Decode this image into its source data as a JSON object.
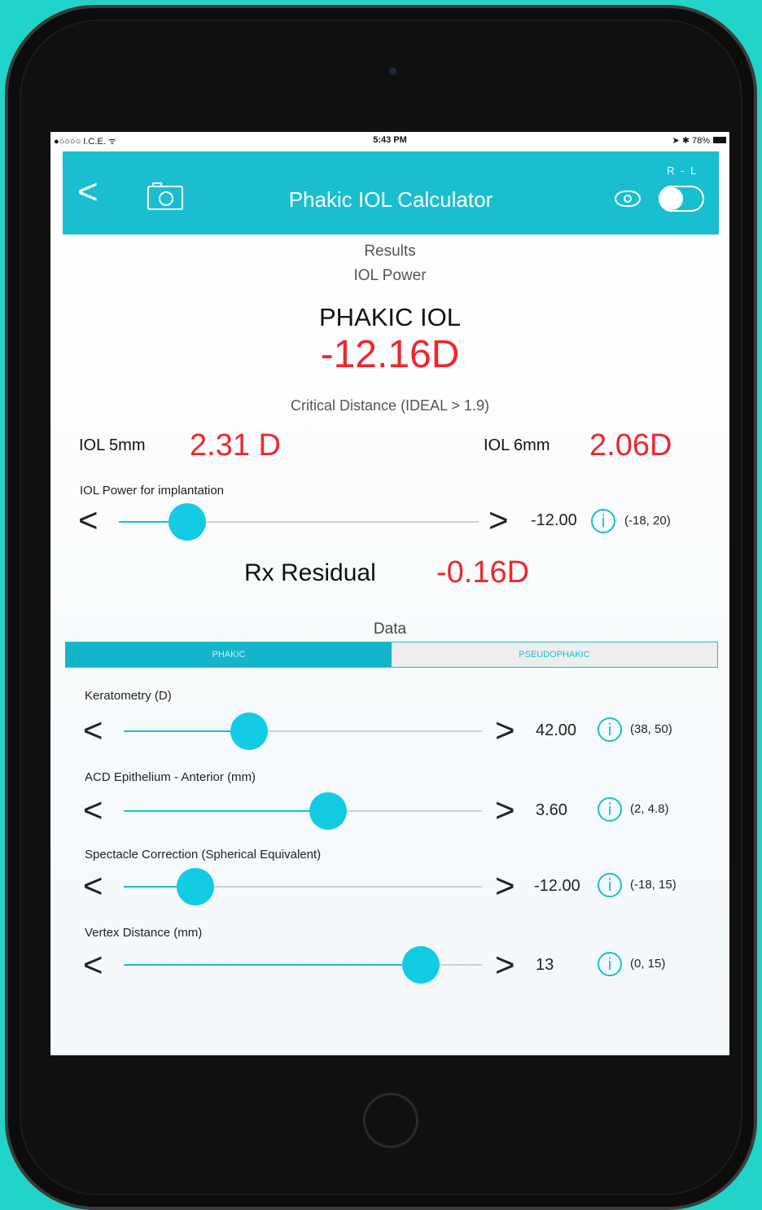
{
  "status_bar": {
    "carrier": "●○○○○ I.C.E. ᯤ",
    "time": "5:43 PM",
    "battery": "➤ ✱ 78%"
  },
  "nav": {
    "back_icon": "chevron-left-icon",
    "camera_icon": "camera-icon",
    "title": "Phakic IOL Calculator",
    "eye_icon": "eye-icon",
    "toggle_label": "R - L",
    "accent_color": "#19bfd0"
  },
  "results": {
    "heading": "Results",
    "subheading": "IOL Power",
    "phakic_label": "PHAKIC IOL",
    "phakic_value": "-12.16D",
    "critical_label": "Critical Distance (IDEAL > 1.9)",
    "iol5_label": "IOL 5mm",
    "iol5_value": "2.31 D",
    "iol6_label": "IOL 6mm",
    "iol6_value": "2.06D",
    "value_color": "#f0262a"
  },
  "implant_slider": {
    "label": "IOL Power for implantation",
    "value": "-12.00",
    "range": "(-18, 20)",
    "position": 0.19
  },
  "residual": {
    "label": "Rx Residual",
    "value": "-0.16D"
  },
  "data_section": {
    "title": "Data",
    "tabs": [
      "PHAKIC",
      "PSEUDOPHAKIC"
    ],
    "selected_tab": "PHAKIC"
  },
  "sliders": [
    {
      "label": "Keratometry (D)",
      "value": "42.00",
      "range": "(38, 50)",
      "position": 0.35
    },
    {
      "label": "ACD Epithelium - Anterior (mm)",
      "value": "3.60",
      "range": "(2, 4.8)",
      "position": 0.57
    },
    {
      "label": "Spectacle Correction (Spherical Equivalent)",
      "value": "-12.00",
      "range": "(-18, 15)",
      "position": 0.2
    },
    {
      "label": "Vertex Distance (mm)",
      "value": "13",
      "range": "(0, 15)",
      "position": 0.83
    }
  ]
}
